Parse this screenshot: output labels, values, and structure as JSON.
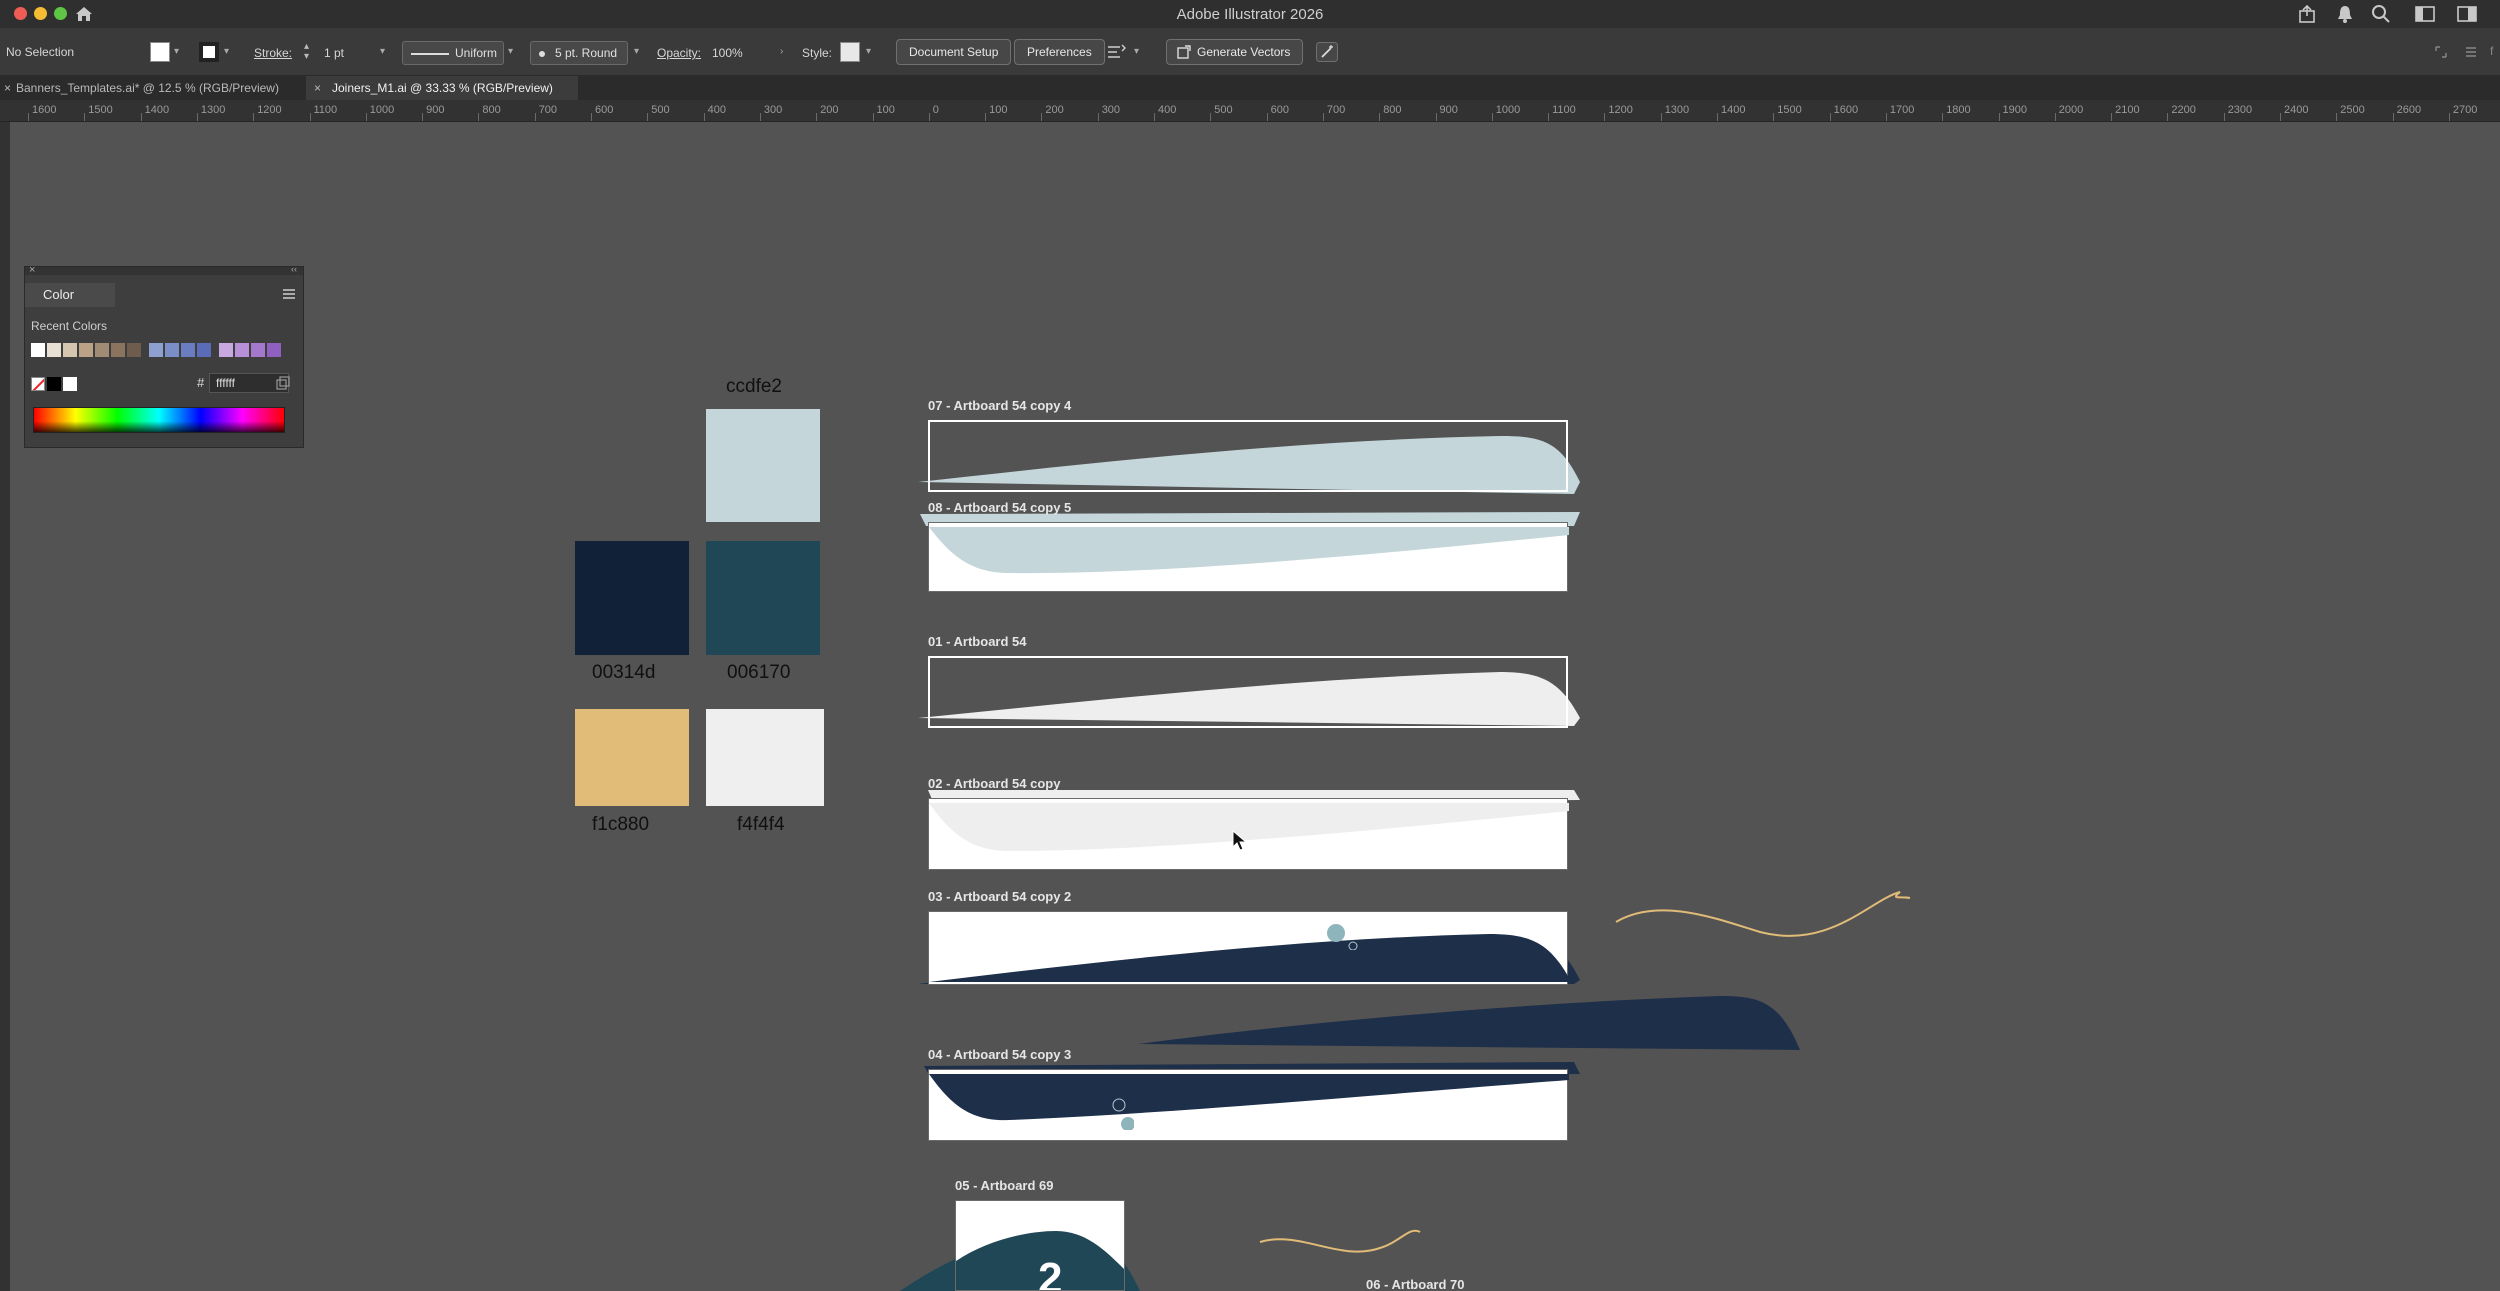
{
  "window": {
    "title": "Adobe Illustrator 2026"
  },
  "control_bar": {
    "selection": "No Selection",
    "stroke_label": "Stroke:",
    "stroke_weight": "1 pt",
    "stroke_profile": "Uniform",
    "brush": "5 pt. Round",
    "opacity_label": "Opacity:",
    "opacity_value": "100%",
    "style_label": "Style:",
    "document_setup": "Document Setup",
    "preferences": "Preferences",
    "generate_vectors": "Generate Vectors"
  },
  "tabs": [
    {
      "label": "Banners_Templates.ai* @ 12.5 % (RGB/Preview)",
      "active": false
    },
    {
      "label": "Joiners_M1.ai @ 33.33 % (RGB/Preview)",
      "active": true
    }
  ],
  "ruler": {
    "ticks": [
      "1600",
      "1500",
      "1400",
      "1300",
      "1200",
      "1100",
      "1000",
      "900",
      "800",
      "700",
      "600",
      "500",
      "400",
      "300",
      "200",
      "100",
      "0",
      "100",
      "200",
      "300",
      "400",
      "500",
      "600",
      "700",
      "800",
      "900",
      "1000",
      "1100",
      "1200",
      "1300",
      "1400",
      "1500",
      "1600",
      "1700",
      "1800",
      "1900",
      "2000",
      "2100",
      "2200",
      "2300",
      "2400",
      "2500",
      "2600",
      "2700"
    ]
  },
  "color_panel": {
    "title": "Color",
    "recent_label": "Recent Colors",
    "recent_colors": [
      "#ffffff",
      "#e8e0d4",
      "#d6c6b0",
      "#b9a286",
      "#a08c74",
      "#8a7460",
      "#6e5c4c",
      "#8da0d0",
      "#7b8ec8",
      "#6a7dc0",
      "#5a6cb8",
      "#c8a8e0",
      "#b890d8",
      "#a478cc",
      "#9060c0"
    ],
    "hex_value": "ffffff"
  },
  "swatches": [
    {
      "label": "ccdfe2",
      "color": "#c4d6d9"
    },
    {
      "label": "00314d",
      "color": "#112238"
    },
    {
      "label": "006170",
      "color": "#1f4756"
    },
    {
      "label": "f1c880",
      "color": "#e1bb78"
    },
    {
      "label": "f4f4f4",
      "color": "#efefef"
    }
  ],
  "artboards": [
    {
      "label": "07 - Artboard 54 copy 4"
    },
    {
      "label": "08 - Artboard 54 copy 5"
    },
    {
      "label": "01 - Artboard 54"
    },
    {
      "label": "02 - Artboard 54 copy"
    },
    {
      "label": "03 - Artboard 54 copy 2"
    },
    {
      "label": "04 - Artboard 54 copy 3"
    },
    {
      "label": "05 - Artboard 69"
    },
    {
      "label": "06 - Artboard 70"
    }
  ],
  "colors": {
    "light_blue": "#c4d6d9",
    "navy": "#1e2f4a",
    "light_gray": "#eeeeee",
    "gold": "#e1bb78",
    "teal": "#1f4756"
  }
}
